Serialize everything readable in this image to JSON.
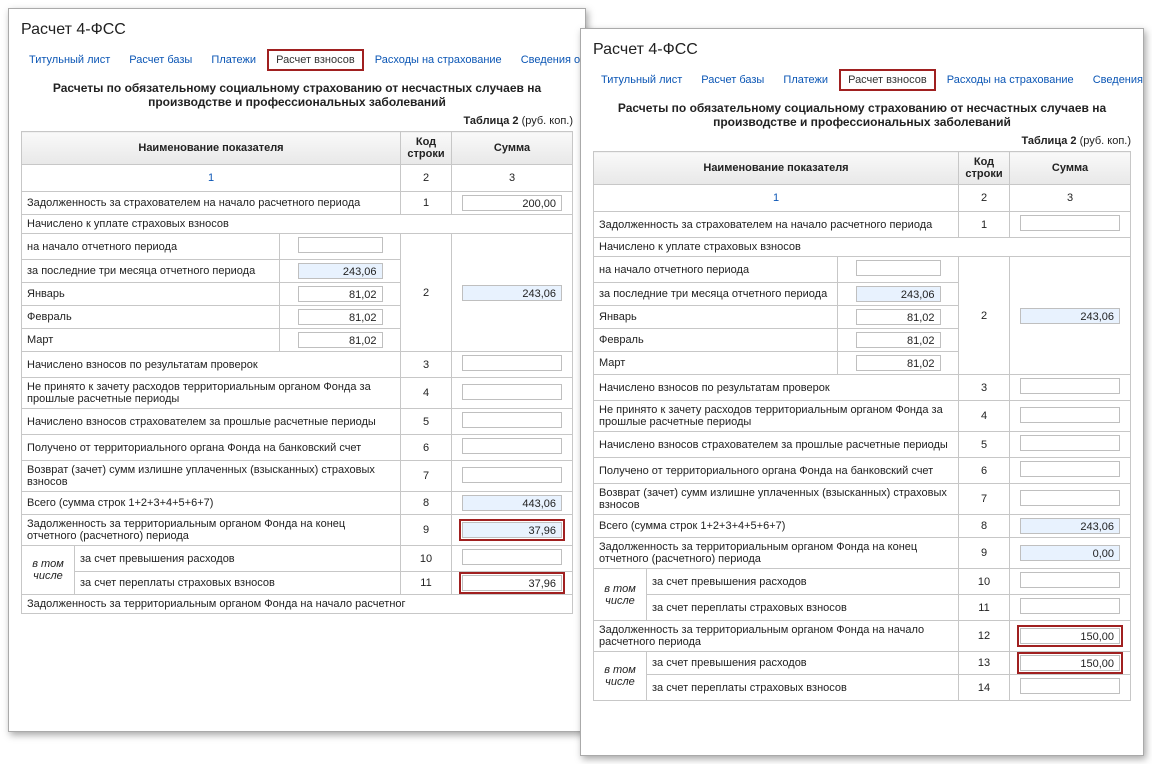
{
  "title": "Расчет 4-ФСС",
  "tabs": [
    "Титульный лист",
    "Расчет базы",
    "Платежи",
    "Расчет взносов",
    "Расходы на страхование",
    "Сведения о спец.оценке"
  ],
  "tabsShortLast": "Сведения о сп",
  "heading": "Расчеты по обязательному социальному страхованию от несчастных случаев на производстве и профессиональных заболеваний",
  "table_caption_b": "Таблица 2",
  "table_caption_unit": " (руб. коп.)",
  "headers": [
    "Наименование показателя",
    "Код строки",
    "Сумма"
  ],
  "numrow": [
    "1",
    "2",
    "3"
  ],
  "rows": {
    "r1": "Задолженность за страхователем на начало расчетного периода",
    "r2": "Начислено к уплате страховых взносов",
    "r2a": "на начало отчетного периода",
    "r2b": "за последние три месяца отчетного периода",
    "r2c": "Январь",
    "r2d": "Февраль",
    "r2e": "Март",
    "r3": "Начислено взносов по результатам проверок",
    "r4": "Не принято к зачету расходов территориальным органом Фонда за прошлые расчетные периоды",
    "r5": "Начислено взносов страхователем за прошлые расчетные периоды",
    "r6": "Получено от территориального органа Фонда на банковский счет",
    "r7": "Возврат (зачет) сумм излишне уплаченных (взысканных) страховых взносов",
    "r8": "Всего (сумма строк 1+2+3+4+5+6+7)",
    "r9": "Задолженность за территориальным органом Фонда на конец отчетного (расчетного) периода",
    "vtomchisle": "в том числе",
    "r10": "за счет превышения расходов",
    "r11": "за счет переплаты страховых взносов",
    "r12": "Задолженность за территориальным органом Фонда на начало расчетного периода",
    "r12short": "Задолженность за территориальным органом Фонда на начало расчетног",
    "r13": "за счет превышения расходов",
    "r14": "за счет переплаты страховых взносов"
  },
  "left": {
    "v1": "200,00",
    "v2b": "243,06",
    "v2c": "81,02",
    "v2d": "81,02",
    "v2e": "81,02",
    "v2tot": "243,06",
    "v8": "443,06",
    "v9": "37,96",
    "v11": "37,96"
  },
  "right": {
    "v2b": "243,06",
    "v2c": "81,02",
    "v2d": "81,02",
    "v2e": "81,02",
    "v2tot": "243,06",
    "v8": "243,06",
    "v9": "0,00",
    "v12": "150,00",
    "v13": "150,00"
  }
}
